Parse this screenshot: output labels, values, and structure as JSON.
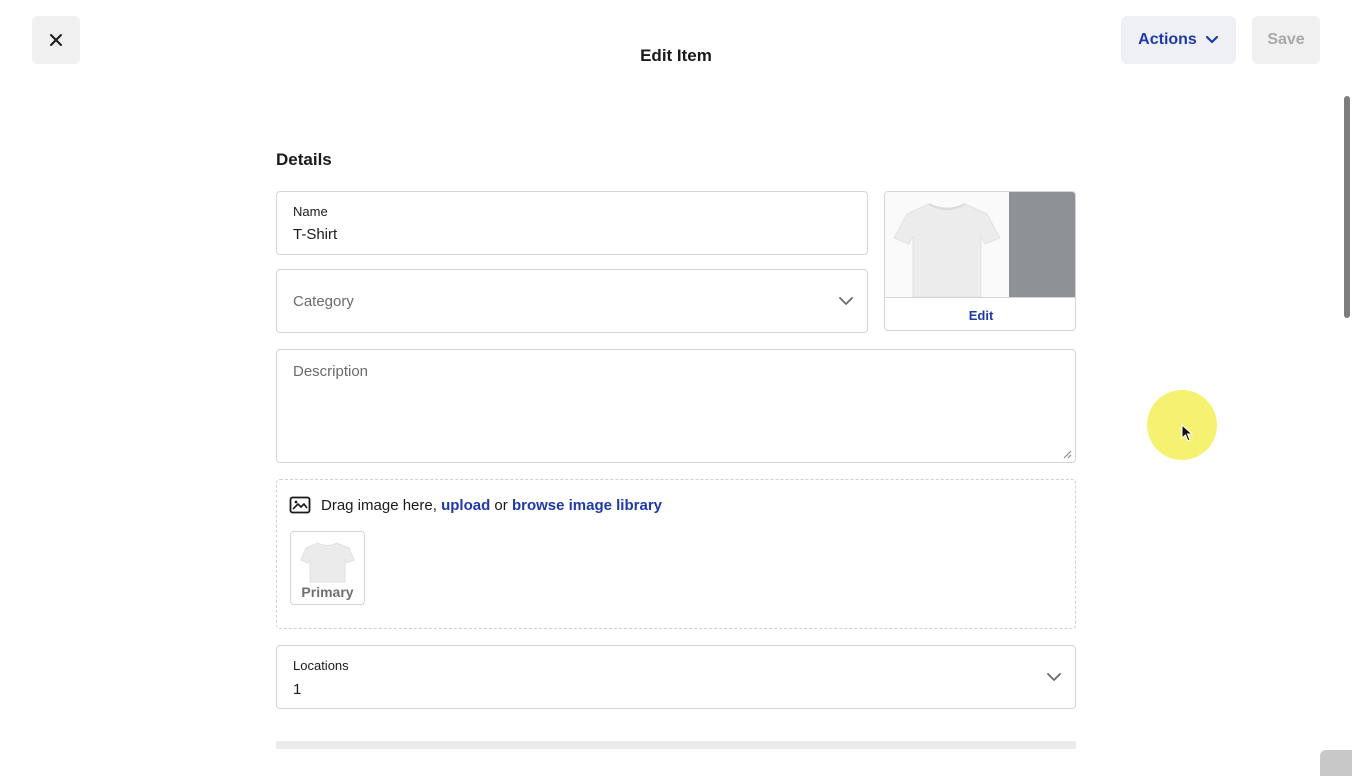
{
  "header": {
    "title": "Edit Item",
    "actions_label": "Actions",
    "save_label": "Save"
  },
  "details": {
    "section_title": "Details",
    "name": {
      "label": "Name",
      "value": "T-Shirt"
    },
    "category": {
      "placeholder": "Category"
    },
    "description": {
      "placeholder": "Description"
    },
    "image_card": {
      "edit_label": "Edit"
    },
    "dropzone": {
      "text_prefix": "Drag image here,",
      "upload_link": "upload",
      "text_or": "or",
      "browse_link": "browse image library",
      "thumb_label": "Primary"
    },
    "locations": {
      "label": "Locations",
      "value": "1"
    }
  },
  "colors": {
    "accent": "#1f3aa8",
    "cursor_highlight": "#f4f16a",
    "image_gray": "#8e9196"
  },
  "icons": {
    "close": "close-icon",
    "actions_chevron": "chevron-down-icon",
    "image": "image-icon"
  }
}
